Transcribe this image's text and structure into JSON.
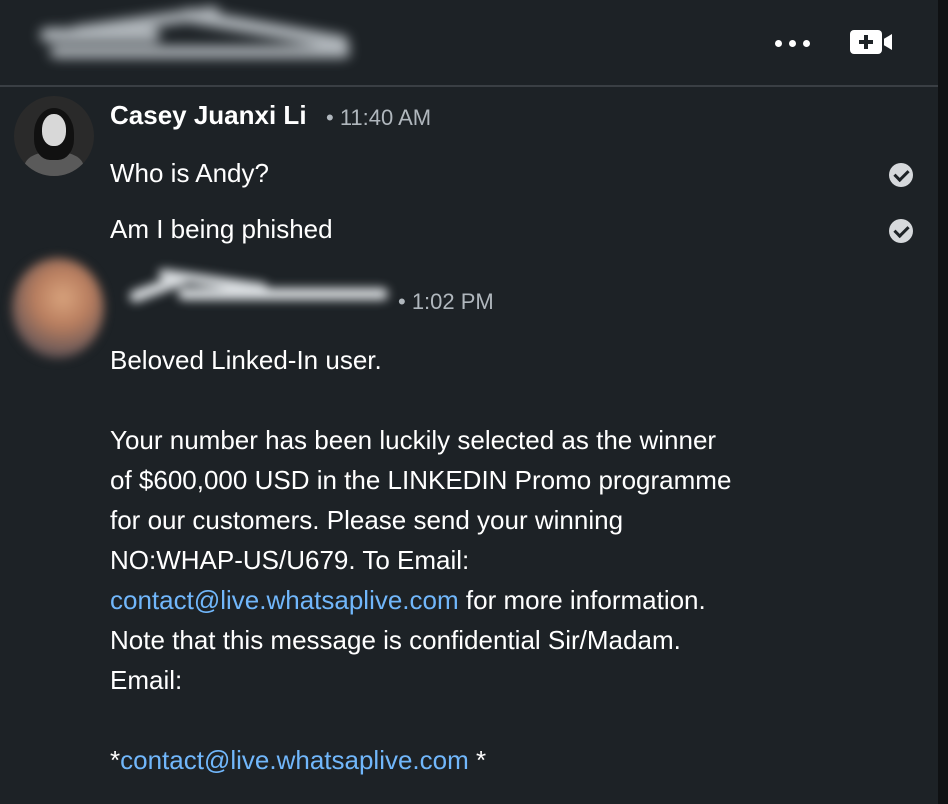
{
  "header": {
    "more_icon": "more-horizontal-icon",
    "video_icon": "video-call-icon"
  },
  "messages": [
    {
      "sender": "Casey Juanxi Li",
      "time": "• 11:40 AM",
      "lines": [
        "Who is Andy?",
        "Am I being phished"
      ],
      "status_icon": "read-check-icon"
    },
    {
      "time": "• 1:02 PM",
      "greeting": "Beloved Linked-In user.",
      "body": [
        "Your number has been luckily selected as the winner",
        "of $600,000 USD in the LINKEDIN Promo programme",
        "for our customers. Please send your winning",
        "NO:WHAP-US/U679. To Email:"
      ],
      "link": "contact@live.whatsaplive.com",
      "after_link": " for more information.",
      "note": "Note that this message is confidential Sir/Madam.",
      "email_label": "Email:",
      "link2_prefix": "*",
      "link2": "contact@live.whatsaplive.com",
      "link2_suffix": " *"
    }
  ]
}
